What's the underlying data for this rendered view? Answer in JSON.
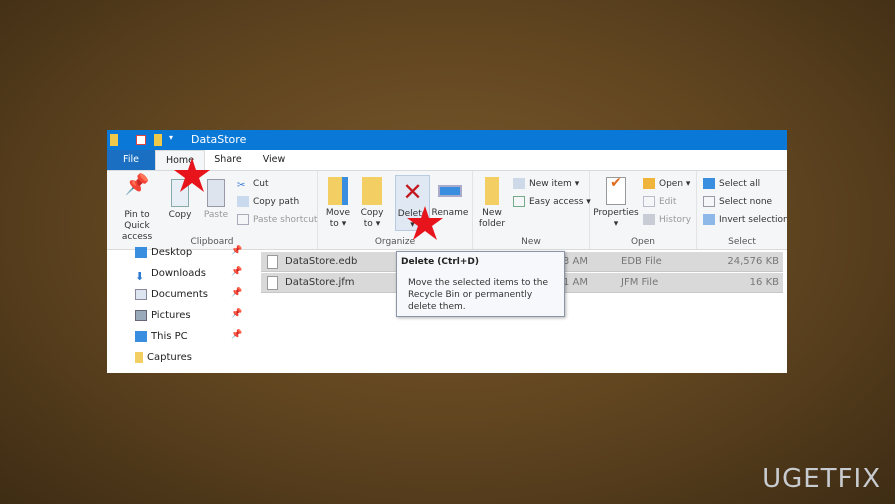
{
  "window": {
    "title": "DataStore"
  },
  "tabs": [
    {
      "label": "File"
    },
    {
      "label": "Home"
    },
    {
      "label": "Share"
    },
    {
      "label": "View"
    }
  ],
  "ribbon": {
    "clipboard": {
      "label": "Clipboard",
      "pin": "Pin to Quick access",
      "pin_l1": "Pin to Quick",
      "pin_l2": "access",
      "copy": "Copy",
      "paste": "Paste",
      "cut": "Cut",
      "copy_path": "Copy path",
      "paste_shortcut": "Paste shortcut"
    },
    "organize": {
      "label": "Organize",
      "move_l1": "Move",
      "move_l2": "to",
      "copy_l1": "Copy",
      "copy_l2": "to",
      "delete": "Delete",
      "rename": "Rename"
    },
    "new": {
      "label": "New",
      "new_folder_l1": "New",
      "new_folder_l2": "folder",
      "new_item": "New item",
      "easy_access": "Easy access"
    },
    "open": {
      "label": "Open",
      "properties": "Properties",
      "open": "Open",
      "edit": "Edit",
      "history": "History"
    },
    "select": {
      "label": "Select",
      "select_all": "Select all",
      "select_none": "Select none",
      "invert": "Invert selection"
    }
  },
  "nav": [
    {
      "label": "Desktop",
      "pinned": true
    },
    {
      "label": "Downloads",
      "pinned": true
    },
    {
      "label": "Documents",
      "pinned": true
    },
    {
      "label": "Pictures",
      "pinned": true
    },
    {
      "label": "This PC",
      "pinned": true
    },
    {
      "label": "Captures",
      "pinned": false
    }
  ],
  "files": [
    {
      "name": "DataStore.edb",
      "time": "3 AM",
      "type": "EDB File",
      "size": "24,576 KB"
    },
    {
      "name": "DataStore.jfm",
      "time": "1 AM",
      "type": "JFM File",
      "size": "16 KB"
    }
  ],
  "tooltip": {
    "title": "Delete (Ctrl+D)",
    "body": "Move the selected items to the Recycle Bin or permanently delete them."
  },
  "watermark": "UGETFIX",
  "colors": {
    "titlebar": "#0a78d7",
    "annotation": "#e8141c"
  }
}
